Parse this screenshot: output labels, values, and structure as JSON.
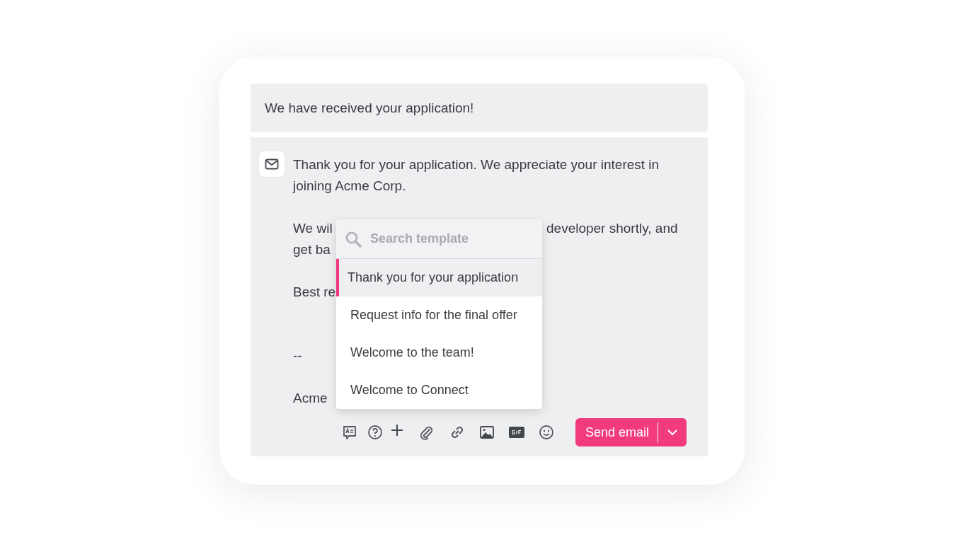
{
  "subject": {
    "value": "We have received your application!"
  },
  "body": {
    "lines": [
      {
        "kind": "text",
        "left": "Thank you for your application. We appreciate your interest in"
      },
      {
        "kind": "text",
        "left": "joining Acme Corp."
      },
      {
        "kind": "blank"
      },
      {
        "kind": "text",
        "left": "We wil",
        "right": "developer shortly, and"
      },
      {
        "kind": "text",
        "left": "get ba"
      },
      {
        "kind": "blank"
      },
      {
        "kind": "text",
        "left": "Best re"
      },
      {
        "kind": "blank"
      },
      {
        "kind": "blank"
      },
      {
        "kind": "text",
        "left": "--"
      },
      {
        "kind": "blank"
      },
      {
        "kind": "text",
        "left": "Acme"
      }
    ]
  },
  "template_menu": {
    "search": {
      "placeholder": "Search template"
    },
    "items": [
      {
        "label": "Thank you for your application",
        "selected": true
      },
      {
        "label": "Request info for the final offer",
        "selected": false
      },
      {
        "label": "Welcome to the team!",
        "selected": false
      },
      {
        "label": "Welcome to Connect",
        "selected": false
      }
    ]
  },
  "send_button": {
    "label": "Send email"
  }
}
